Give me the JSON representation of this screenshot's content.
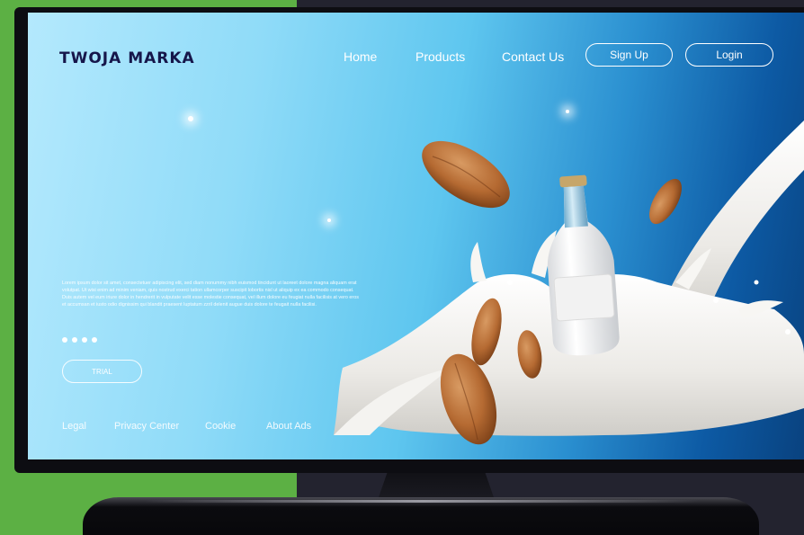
{
  "brand": {
    "name": "TWOJA MARKA"
  },
  "nav": {
    "home": "Home",
    "products": "Products",
    "contact": "Contact Us",
    "signup": "Sign Up",
    "login": "Login"
  },
  "hero": {
    "body": "Lorem ipsum dolor sit amet, consectetuer adipiscing elit, sed diam nonummy nibh euismod tincidunt ut laoreet dolore magna aliquam erat volutpat. Ut wisi enim ad minim veniam, quis nostrud exerci tation ullamcorper suscipit lobortis nisl ut aliquip ex ea commodo consequat. Duis autem vel eum iriure dolor in hendrerit in vulputate velit esse molestie consequat, vel illum dolore eu feugiat nulla facilisis at vero eros et accumsan et iusto odio dignissim qui blandit praesent luptatum zzril delenit augue duis dolore te feugait nulla facilisi.",
    "trial": "TRIAL"
  },
  "footer": {
    "legal": "Legal",
    "privacy": "Privacy Center",
    "cookie": "Cookie",
    "about_ads": "About Ads"
  },
  "colors": {
    "brand_text": "#16164a",
    "screen_light": "#b4e9fd",
    "screen_dark": "#09427f",
    "background_green": "#5cb044"
  }
}
